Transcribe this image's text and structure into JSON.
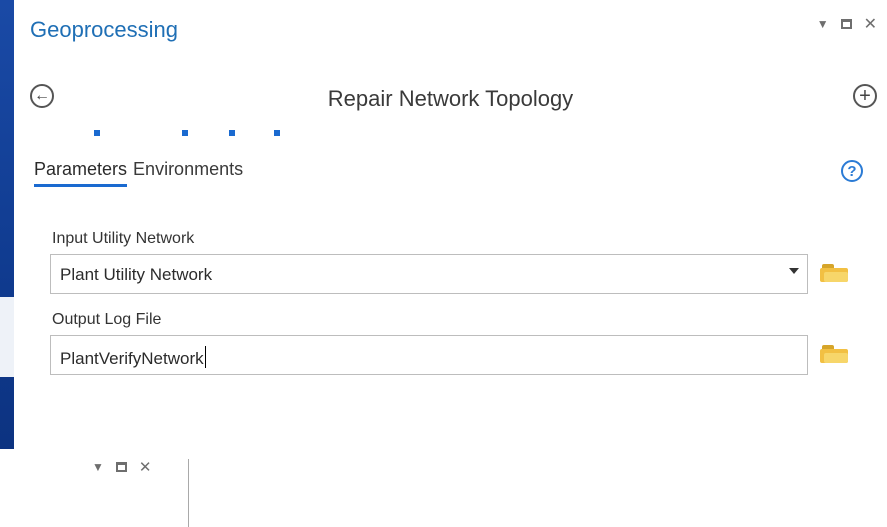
{
  "panel": {
    "title": "Geoprocessing",
    "tool_title": "Repair Network Topology"
  },
  "tabs": [
    {
      "label": "Parameters",
      "active": true
    },
    {
      "label": "Environments",
      "active": false
    }
  ],
  "help_label": "?",
  "fields": {
    "input_network": {
      "label": "Input Utility Network",
      "value": "Plant Utility Network"
    },
    "output_log": {
      "label": "Output Log File",
      "value": "PlantVerifyNetwork"
    }
  },
  "window_controls": [
    "chevron-down-icon",
    "maximize-icon",
    "close-icon"
  ],
  "colors": {
    "title": "#1f6fb5",
    "accent": "#1a6ad0",
    "folder": "#f2c043",
    "background": "#0e3a8c"
  }
}
